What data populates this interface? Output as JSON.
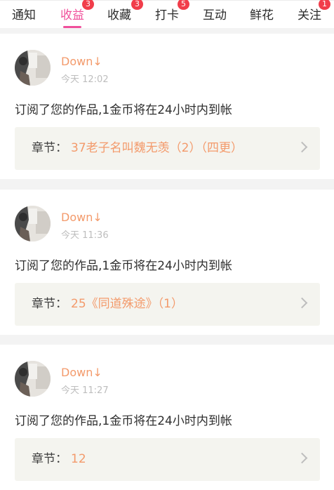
{
  "tabs": [
    {
      "label": "通知",
      "badge": null
    },
    {
      "label": "收益",
      "badge": "3",
      "active": true
    },
    {
      "label": "收藏",
      "badge": "3"
    },
    {
      "label": "打卡",
      "badge": "5"
    },
    {
      "label": "互动",
      "badge": null
    },
    {
      "label": "鲜花",
      "badge": null
    },
    {
      "label": "关注",
      "badge": "1"
    }
  ],
  "colors": {
    "accent_pink": "#f0509b",
    "accent_orange": "#f39a6b",
    "badge_red": "#f13d4a"
  },
  "notifications": [
    {
      "user": "Down↓",
      "time": "今天 12:02",
      "message": "订阅了您的作品,1金币将在24小时内到帐",
      "chapter_label": "章节：",
      "chapter_value": "37老子名叫魏无羡（2）（四更）"
    },
    {
      "user": "Down↓",
      "time": "今天 11:36",
      "message": "订阅了您的作品,1金币将在24小时内到帐",
      "chapter_label": "章节：",
      "chapter_value": "25《同道殊途》（1）"
    },
    {
      "user": "Down↓",
      "time": "今天 11:27",
      "message": "订阅了您的作品,1金币将在24小时内到帐",
      "chapter_label": "章节：",
      "chapter_value": "12"
    }
  ]
}
